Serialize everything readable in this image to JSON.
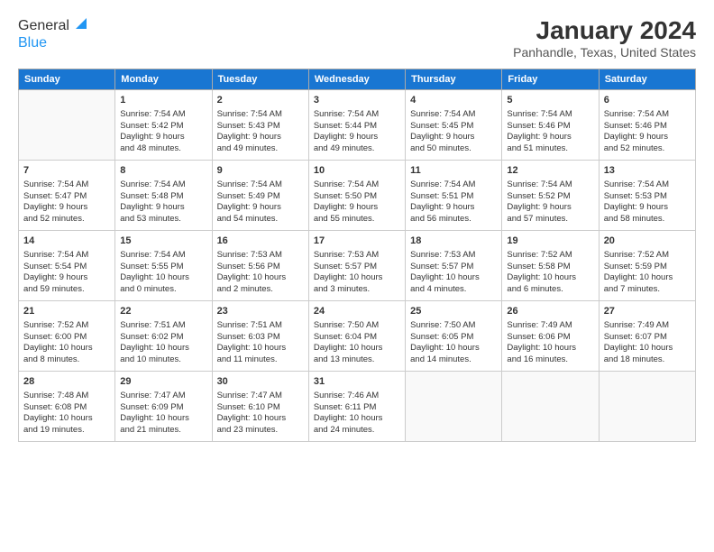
{
  "header": {
    "logo_general": "General",
    "logo_blue": "Blue",
    "title": "January 2024",
    "subtitle": "Panhandle, Texas, United States"
  },
  "weekdays": [
    "Sunday",
    "Monday",
    "Tuesday",
    "Wednesday",
    "Thursday",
    "Friday",
    "Saturday"
  ],
  "weeks": [
    [
      {
        "day": "",
        "info": ""
      },
      {
        "day": "1",
        "info": "Sunrise: 7:54 AM\nSunset: 5:42 PM\nDaylight: 9 hours\nand 48 minutes."
      },
      {
        "day": "2",
        "info": "Sunrise: 7:54 AM\nSunset: 5:43 PM\nDaylight: 9 hours\nand 49 minutes."
      },
      {
        "day": "3",
        "info": "Sunrise: 7:54 AM\nSunset: 5:44 PM\nDaylight: 9 hours\nand 49 minutes."
      },
      {
        "day": "4",
        "info": "Sunrise: 7:54 AM\nSunset: 5:45 PM\nDaylight: 9 hours\nand 50 minutes."
      },
      {
        "day": "5",
        "info": "Sunrise: 7:54 AM\nSunset: 5:46 PM\nDaylight: 9 hours\nand 51 minutes."
      },
      {
        "day": "6",
        "info": "Sunrise: 7:54 AM\nSunset: 5:46 PM\nDaylight: 9 hours\nand 52 minutes."
      }
    ],
    [
      {
        "day": "7",
        "info": "Sunrise: 7:54 AM\nSunset: 5:47 PM\nDaylight: 9 hours\nand 52 minutes."
      },
      {
        "day": "8",
        "info": "Sunrise: 7:54 AM\nSunset: 5:48 PM\nDaylight: 9 hours\nand 53 minutes."
      },
      {
        "day": "9",
        "info": "Sunrise: 7:54 AM\nSunset: 5:49 PM\nDaylight: 9 hours\nand 54 minutes."
      },
      {
        "day": "10",
        "info": "Sunrise: 7:54 AM\nSunset: 5:50 PM\nDaylight: 9 hours\nand 55 minutes."
      },
      {
        "day": "11",
        "info": "Sunrise: 7:54 AM\nSunset: 5:51 PM\nDaylight: 9 hours\nand 56 minutes."
      },
      {
        "day": "12",
        "info": "Sunrise: 7:54 AM\nSunset: 5:52 PM\nDaylight: 9 hours\nand 57 minutes."
      },
      {
        "day": "13",
        "info": "Sunrise: 7:54 AM\nSunset: 5:53 PM\nDaylight: 9 hours\nand 58 minutes."
      }
    ],
    [
      {
        "day": "14",
        "info": "Sunrise: 7:54 AM\nSunset: 5:54 PM\nDaylight: 9 hours\nand 59 minutes."
      },
      {
        "day": "15",
        "info": "Sunrise: 7:54 AM\nSunset: 5:55 PM\nDaylight: 10 hours\nand 0 minutes."
      },
      {
        "day": "16",
        "info": "Sunrise: 7:53 AM\nSunset: 5:56 PM\nDaylight: 10 hours\nand 2 minutes."
      },
      {
        "day": "17",
        "info": "Sunrise: 7:53 AM\nSunset: 5:57 PM\nDaylight: 10 hours\nand 3 minutes."
      },
      {
        "day": "18",
        "info": "Sunrise: 7:53 AM\nSunset: 5:57 PM\nDaylight: 10 hours\nand 4 minutes."
      },
      {
        "day": "19",
        "info": "Sunrise: 7:52 AM\nSunset: 5:58 PM\nDaylight: 10 hours\nand 6 minutes."
      },
      {
        "day": "20",
        "info": "Sunrise: 7:52 AM\nSunset: 5:59 PM\nDaylight: 10 hours\nand 7 minutes."
      }
    ],
    [
      {
        "day": "21",
        "info": "Sunrise: 7:52 AM\nSunset: 6:00 PM\nDaylight: 10 hours\nand 8 minutes."
      },
      {
        "day": "22",
        "info": "Sunrise: 7:51 AM\nSunset: 6:02 PM\nDaylight: 10 hours\nand 10 minutes."
      },
      {
        "day": "23",
        "info": "Sunrise: 7:51 AM\nSunset: 6:03 PM\nDaylight: 10 hours\nand 11 minutes."
      },
      {
        "day": "24",
        "info": "Sunrise: 7:50 AM\nSunset: 6:04 PM\nDaylight: 10 hours\nand 13 minutes."
      },
      {
        "day": "25",
        "info": "Sunrise: 7:50 AM\nSunset: 6:05 PM\nDaylight: 10 hours\nand 14 minutes."
      },
      {
        "day": "26",
        "info": "Sunrise: 7:49 AM\nSunset: 6:06 PM\nDaylight: 10 hours\nand 16 minutes."
      },
      {
        "day": "27",
        "info": "Sunrise: 7:49 AM\nSunset: 6:07 PM\nDaylight: 10 hours\nand 18 minutes."
      }
    ],
    [
      {
        "day": "28",
        "info": "Sunrise: 7:48 AM\nSunset: 6:08 PM\nDaylight: 10 hours\nand 19 minutes."
      },
      {
        "day": "29",
        "info": "Sunrise: 7:47 AM\nSunset: 6:09 PM\nDaylight: 10 hours\nand 21 minutes."
      },
      {
        "day": "30",
        "info": "Sunrise: 7:47 AM\nSunset: 6:10 PM\nDaylight: 10 hours\nand 23 minutes."
      },
      {
        "day": "31",
        "info": "Sunrise: 7:46 AM\nSunset: 6:11 PM\nDaylight: 10 hours\nand 24 minutes."
      },
      {
        "day": "",
        "info": ""
      },
      {
        "day": "",
        "info": ""
      },
      {
        "day": "",
        "info": ""
      }
    ]
  ]
}
